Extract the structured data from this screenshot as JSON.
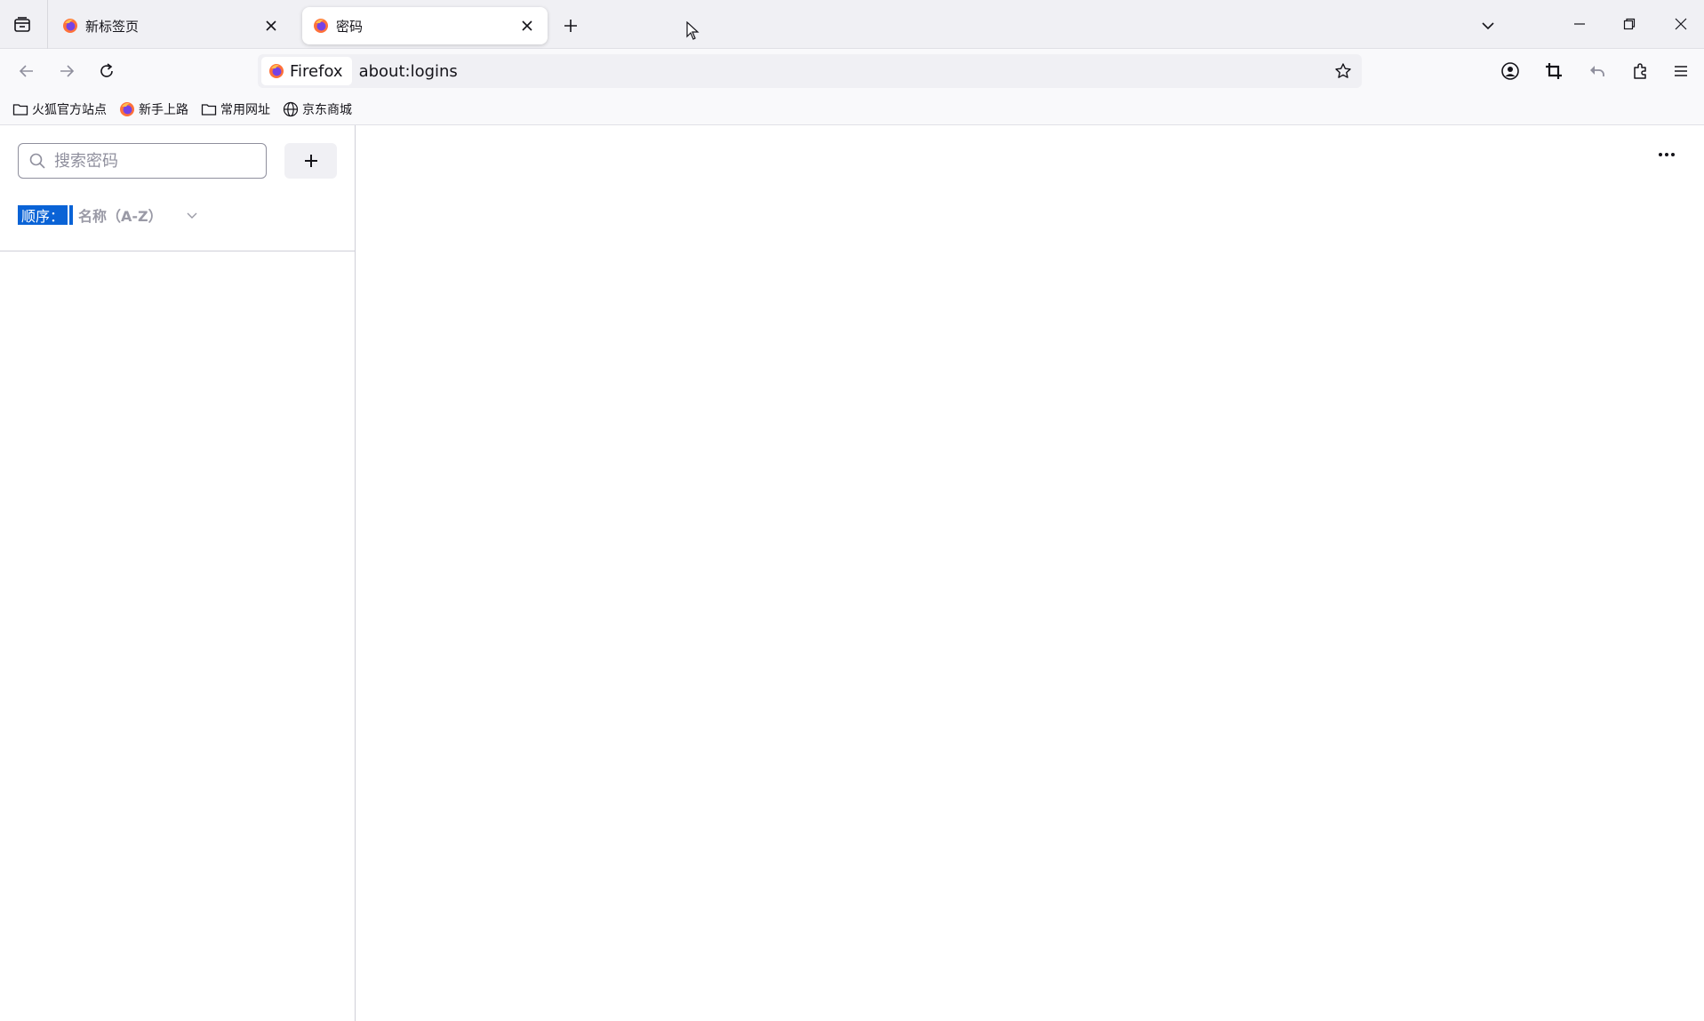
{
  "tabs": [
    {
      "title": "新标签页",
      "active": false,
      "icon": "firefox-icon"
    },
    {
      "title": "密码",
      "active": true,
      "icon": "firefox-icon"
    }
  ],
  "urlbar": {
    "identity_label": "Firefox",
    "url": "about:logins"
  },
  "bookmarks": [
    {
      "label": "火狐官方站点",
      "icon": "folder-icon"
    },
    {
      "label": "新手上路",
      "icon": "firefox-icon"
    },
    {
      "label": "常用网址",
      "icon": "folder-icon"
    },
    {
      "label": "京东商城",
      "icon": "globe-icon"
    }
  ],
  "sidebar": {
    "search_placeholder": "搜索密码",
    "sort_label": "顺序：",
    "sort_value": "名称（A-Z）"
  },
  "colors": {
    "accent": "#0a63d6",
    "tabstrip_bg": "#f0f0f4",
    "toolbar_bg": "#f9f9fb"
  }
}
